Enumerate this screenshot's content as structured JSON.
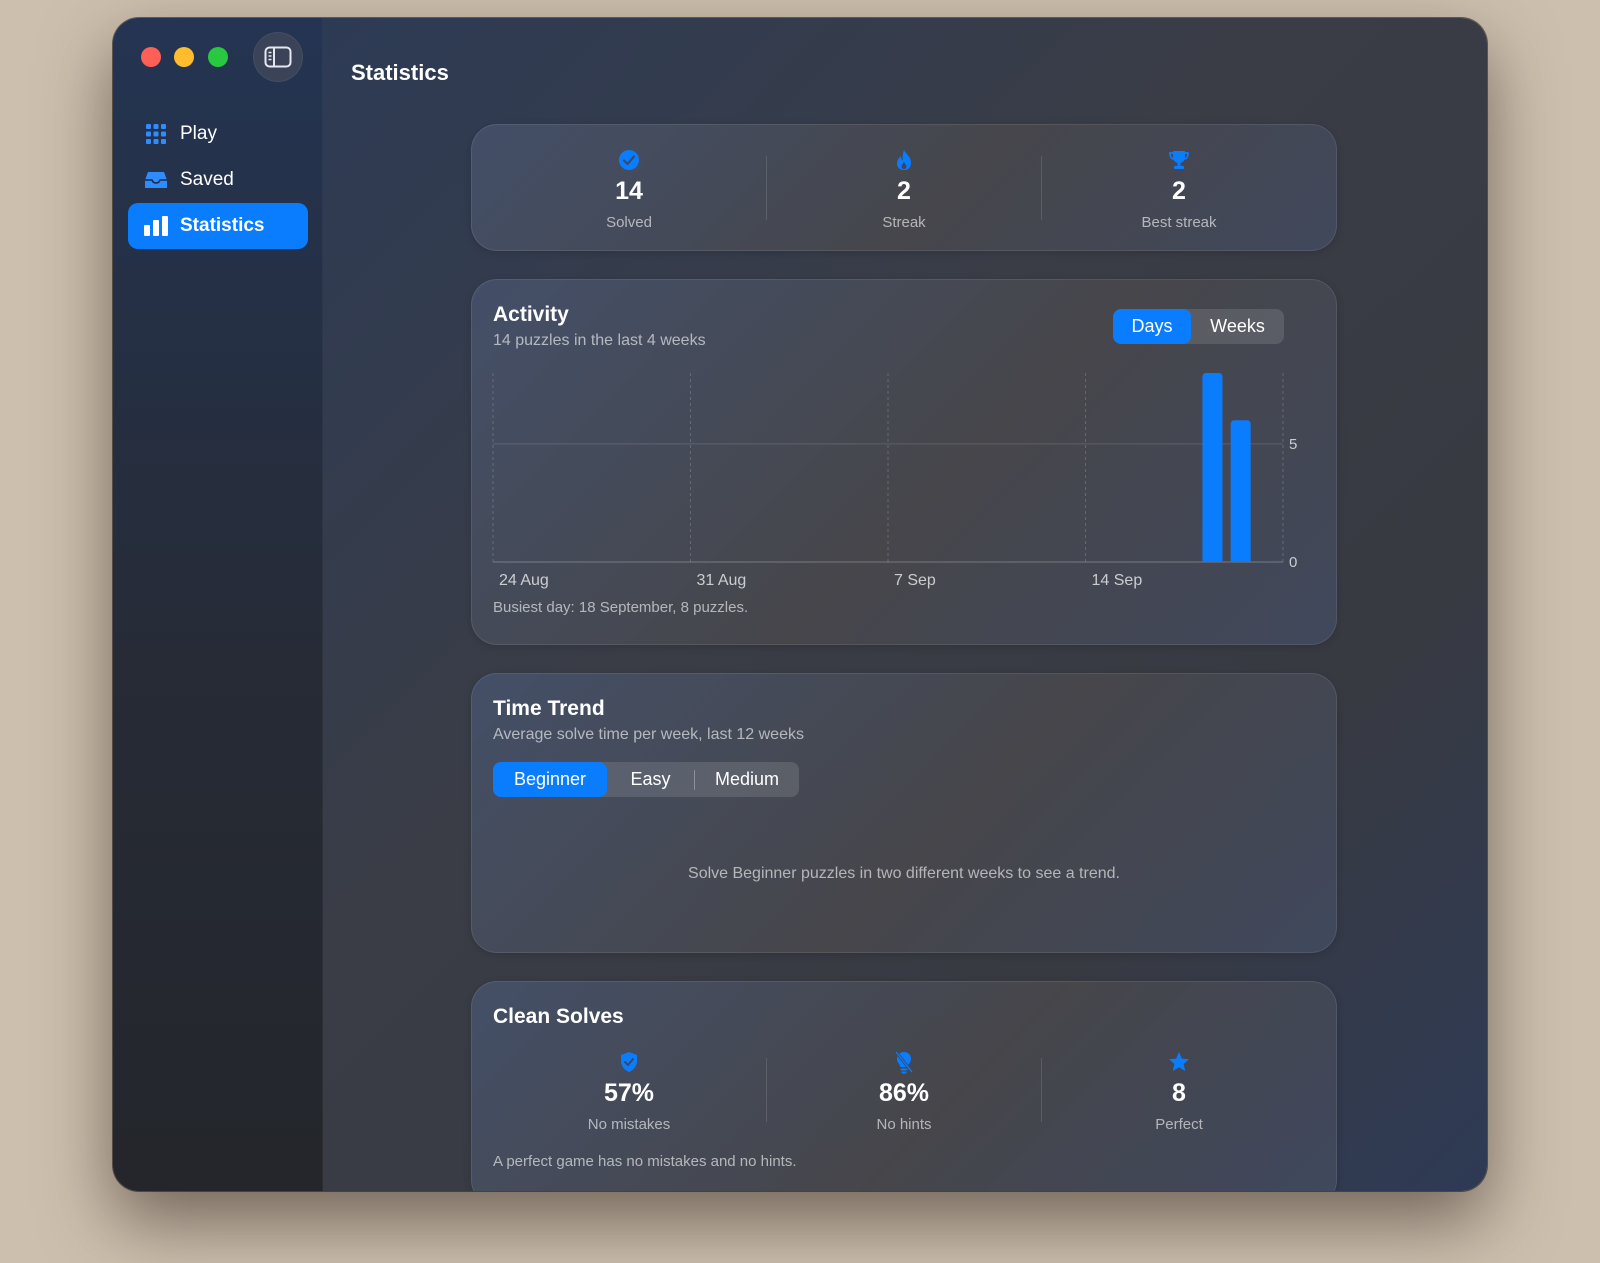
{
  "window": {
    "title": "Statistics"
  },
  "sidebar": {
    "items": [
      {
        "label": "Play",
        "icon": "grid-icon",
        "active": false
      },
      {
        "label": "Saved",
        "icon": "tray-icon",
        "active": false
      },
      {
        "label": "Statistics",
        "icon": "chart-bar-icon",
        "active": true
      }
    ]
  },
  "summary": [
    {
      "value": "14",
      "label": "Solved",
      "icon": "checkmark-seal-icon"
    },
    {
      "value": "2",
      "label": "Streak",
      "icon": "flame-icon"
    },
    {
      "value": "2",
      "label": "Best streak",
      "icon": "trophy-icon"
    }
  ],
  "activity": {
    "title": "Activity",
    "subtitle": "14 puzzles in the last 4 weeks",
    "segments": [
      "Days",
      "Weeks"
    ],
    "selected_segment": "Days",
    "footnote": "Busiest day: 18 September, 8 puzzles."
  },
  "chart_data": {
    "type": "bar",
    "x_tick_labels": [
      "24 Aug",
      "31 Aug",
      "7 Sep",
      "14 Sep"
    ],
    "y_tick_labels": [
      "0",
      "5"
    ],
    "ylim": [
      0,
      8
    ],
    "yticks": [
      0,
      5
    ],
    "day_count": 28,
    "bars": [
      {
        "day_index": 25,
        "date": "18 September",
        "value": 8
      },
      {
        "day_index": 26,
        "value": 6
      }
    ],
    "grid": true,
    "color": "#0a7dff"
  },
  "time_trend": {
    "title": "Time Trend",
    "subtitle": "Average solve time per week, last 12 weeks",
    "segments": [
      "Beginner",
      "Easy",
      "Medium"
    ],
    "selected_segment": "Beginner",
    "empty_message": "Solve Beginner puzzles in two different weeks to see a trend."
  },
  "clean_solves": {
    "title": "Clean Solves",
    "stats": [
      {
        "value": "57%",
        "label": "No mistakes",
        "icon": "shield-check-icon"
      },
      {
        "value": "86%",
        "label": "No hints",
        "icon": "lightbulb-slash-icon"
      },
      {
        "value": "8",
        "label": "Perfect",
        "icon": "star-icon"
      }
    ],
    "footnote": "A perfect game has no mistakes and no hints."
  },
  "colors": {
    "accent": "#0a7dff",
    "close": "#fe5f57",
    "minimize": "#febc2e",
    "zoom": "#28c840"
  }
}
